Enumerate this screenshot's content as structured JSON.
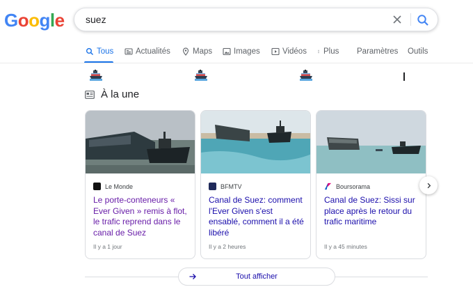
{
  "logo": {
    "letters": [
      "G",
      "o",
      "o",
      "g",
      "l",
      "e"
    ],
    "colors": [
      "#4285f4",
      "#ea4335",
      "#fbbc05",
      "#4285f4",
      "#34a853",
      "#ea4335"
    ]
  },
  "search": {
    "query": "suez"
  },
  "tabs": [
    {
      "label": "Tous",
      "icon": "search-icon",
      "active": true
    },
    {
      "label": "Actualités",
      "icon": "news-icon"
    },
    {
      "label": "Maps",
      "icon": "map-pin-icon"
    },
    {
      "label": "Images",
      "icon": "image-icon"
    },
    {
      "label": "Vidéos",
      "icon": "video-icon"
    },
    {
      "label": "Plus",
      "icon": "more-vert-icon"
    },
    {
      "label": "Paramètres"
    },
    {
      "label": "Outils"
    }
  ],
  "section": {
    "title": "À la une",
    "icon": "newspaper-icon"
  },
  "cards": [
    {
      "source": "Le Monde",
      "headline": "Le porte-conteneurs « Ever Given » remis à flot, le trafic reprend dans le canal de Suez",
      "time": "Il y a 1 jour",
      "visited": true,
      "favicon_color": "#111111"
    },
    {
      "source": "BFMTV",
      "headline": "Canal de Suez: comment l'Ever Given s'est ensablé, comment il a été libéré",
      "time": "Il y a 2 heures",
      "visited": false,
      "favicon_color": "#1f2a5a"
    },
    {
      "source": "Boursorama",
      "headline": "Canal de Suez: Sissi sur place après le retour du trafic maritime",
      "time": "Il y a 45 minutes",
      "visited": false,
      "favicon_color": "#e2007a"
    }
  ],
  "show_all": {
    "label": "Tout afficher"
  },
  "colors": {
    "accent": "#1a73e8",
    "link": "#1a0dab",
    "visited": "#681da8"
  }
}
